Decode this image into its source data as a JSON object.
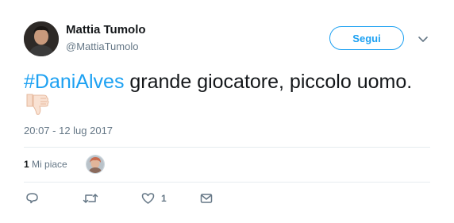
{
  "user": {
    "name": "Mattia Tumolo",
    "handle": "@MattiaTumolo"
  },
  "follow_button": {
    "label": "Segui"
  },
  "tweet": {
    "hashtag": "#DaniAlves",
    "text": " grande giocatore, piccolo uomo.",
    "emoji": "thumbs-down"
  },
  "timestamp": "20:07 - 12 lug 2017",
  "stats": {
    "likes_count": "1",
    "likes_label": "Mi piace"
  },
  "actions": {
    "reply_icon": "reply-icon",
    "retweet_icon": "retweet-icon",
    "like_icon": "heart-icon",
    "like_count": "1",
    "dm_icon": "envelope-icon"
  },
  "colors": {
    "accent": "#1da1f2",
    "secondary_text": "#657786",
    "divider": "#e6ecf0"
  }
}
